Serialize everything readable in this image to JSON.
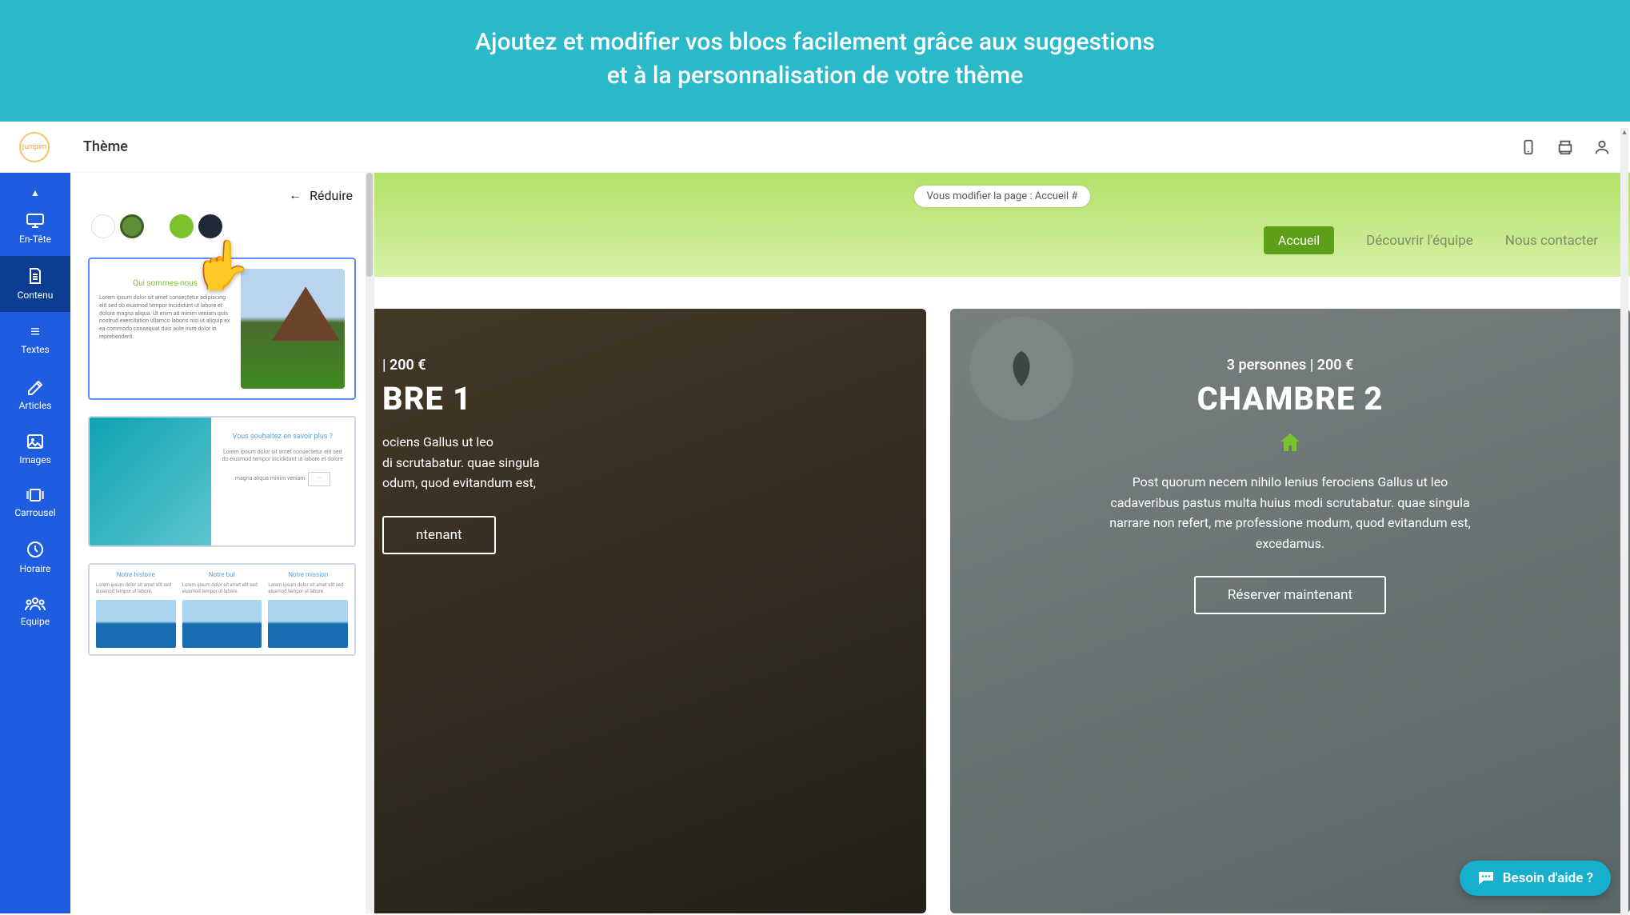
{
  "banner": {
    "line1": "Ajoutez et modifier vos blocs facilement grâce aux suggestions",
    "line2": "et à la personnalisation de votre thème"
  },
  "topbar": {
    "logo_text": "jumpim",
    "title": "Thème"
  },
  "sidenav": {
    "items": [
      {
        "label": "En-Tête",
        "icon": "monitor-icon"
      },
      {
        "label": "Contenu",
        "icon": "document-icon",
        "active": true
      },
      {
        "label": "Textes",
        "icon": "lines-icon"
      },
      {
        "label": "Articles",
        "icon": "edit-icon"
      },
      {
        "label": "Images",
        "icon": "image-icon"
      },
      {
        "label": "Carrousel",
        "icon": "carousel-icon"
      },
      {
        "label": "Horaire",
        "icon": "clock-icon"
      },
      {
        "label": "Equipe",
        "icon": "team-icon"
      }
    ]
  },
  "panel": {
    "reduce_label": "Réduire",
    "colors": {
      "pair1_a": "#ffffff",
      "pair1_b": "#5f8f34",
      "pair2_a": "#7cc22e",
      "pair2_b": "#1f2a37"
    },
    "block1_heading": "Qui sommes-nous",
    "block2_heading": "Vous souhaitez en savoir plus ?",
    "block3_cols": [
      "Notre histoire",
      "Notre but",
      "Notre mission"
    ]
  },
  "canvas": {
    "notice": "Vous modifier la page : Accueil #",
    "nav": {
      "pill": "Accueil",
      "link1": "Découvrir l'équipe",
      "link2": "Nous contacter"
    },
    "rooms": [
      {
        "meta_suffix": "| 200 €",
        "name_suffix": "BRE 1",
        "desc": "ociens Gallus ut leo\ndi scrutabatur. quae singula\nodum, quod evitandum est,",
        "cta_suffix": "ntenant"
      },
      {
        "meta": "3 personnes | 200 €",
        "name": "CHAMBRE 2",
        "desc": "Post quorum necem nihilo lenius ferociens Gallus ut leo cadaveribus pastus multa huius modi scrutabatur. quae singula narrare non refert, me professione modum, quod evitandum est, excedamus.",
        "cta": "Réserver maintenant"
      }
    ]
  },
  "help": {
    "label": "Besoin d'aide ?"
  }
}
